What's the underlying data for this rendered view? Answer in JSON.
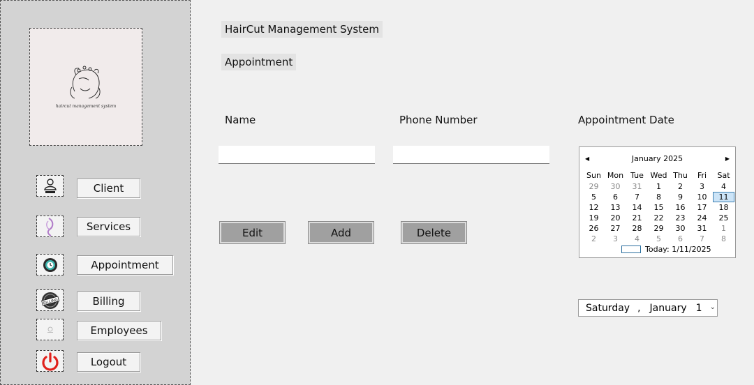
{
  "sidebar": {
    "logo_text": "haircut management system",
    "items": [
      {
        "label": "Client",
        "icon": "client-icon"
      },
      {
        "label": "Services",
        "icon": "services-icon"
      },
      {
        "label": "Appointment",
        "icon": "appointment-icon"
      },
      {
        "label": "Billing",
        "icon": "billing-icon"
      },
      {
        "label": "Employees",
        "icon": "employees-icon"
      },
      {
        "label": "Logout",
        "icon": "power-icon"
      }
    ]
  },
  "header": {
    "app_title": "HairCut Management System",
    "page_title": "Appointment"
  },
  "form": {
    "name_label": "Name",
    "phone_label": "Phone Number",
    "date_label": "Appointment Date",
    "name_value": "",
    "phone_value": ""
  },
  "actions": {
    "edit_label": "Edit",
    "add_label": "Add",
    "delete_label": "Delete"
  },
  "calendar": {
    "month_title": "January 2025",
    "weekdays": [
      "Sun",
      "Mon",
      "Tue",
      "Wed",
      "Thu",
      "Fri",
      "Sat"
    ],
    "weeks": [
      [
        "29",
        "30",
        "31",
        "1",
        "2",
        "3",
        "4"
      ],
      [
        "5",
        "6",
        "7",
        "8",
        "9",
        "10",
        "11"
      ],
      [
        "12",
        "13",
        "14",
        "15",
        "16",
        "17",
        "18"
      ],
      [
        "19",
        "20",
        "21",
        "22",
        "23",
        "24",
        "25"
      ],
      [
        "26",
        "27",
        "28",
        "29",
        "30",
        "31",
        "1"
      ],
      [
        "2",
        "3",
        "4",
        "5",
        "6",
        "7",
        "8"
      ]
    ],
    "selected_day": "11",
    "today_text": "Today: 1/11/2025"
  },
  "date_picker": {
    "weekday": "Saturday",
    "separator": ",",
    "month": "January",
    "day": "1"
  },
  "colors": {
    "sidebar_bg": "#d3d3d3",
    "page_bg": "#f0f0f0",
    "action_button_bg": "#a0a0a0",
    "selected_day_border": "#3c7fb1",
    "power_icon": "#e0201b"
  }
}
